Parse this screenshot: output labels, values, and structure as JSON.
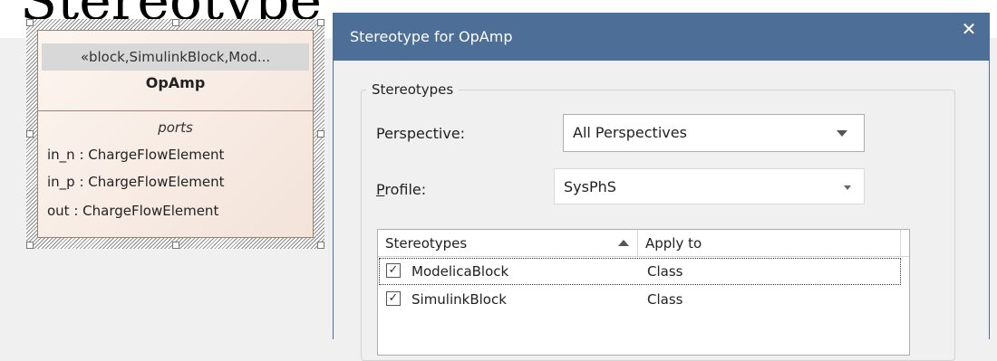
{
  "background": {
    "heading_fragment": "Stereotype"
  },
  "block": {
    "stereotype": "«block,SimulinkBlock,Mod...",
    "name": "OpAmp",
    "compartment_title": "ports",
    "ports": [
      "in_n : ChargeFlowElement",
      "in_p : ChargeFlowElement",
      "out : ChargeFlowElement"
    ]
  },
  "dialog": {
    "title": "Stereotype for OpAmp",
    "close_glyph": "✕",
    "group_label": "Stereotypes",
    "perspective_label": "Perspective:",
    "perspective_value": "All Perspectives",
    "profile_label_first": "P",
    "profile_label_rest": "rofile:",
    "profile_value": "SysPhS",
    "list": {
      "columns": [
        "Stereotypes",
        "Apply to"
      ],
      "rows": [
        {
          "name": "ModelicaBlock",
          "apply_to": "Class",
          "checked": true
        },
        {
          "name": "SimulinkBlock",
          "apply_to": "Class",
          "checked": true
        }
      ]
    }
  },
  "colors": {
    "titlebar": "#4d6e96",
    "block_fill": "#f3e3d9",
    "window_bg": "#f0f0f0"
  }
}
